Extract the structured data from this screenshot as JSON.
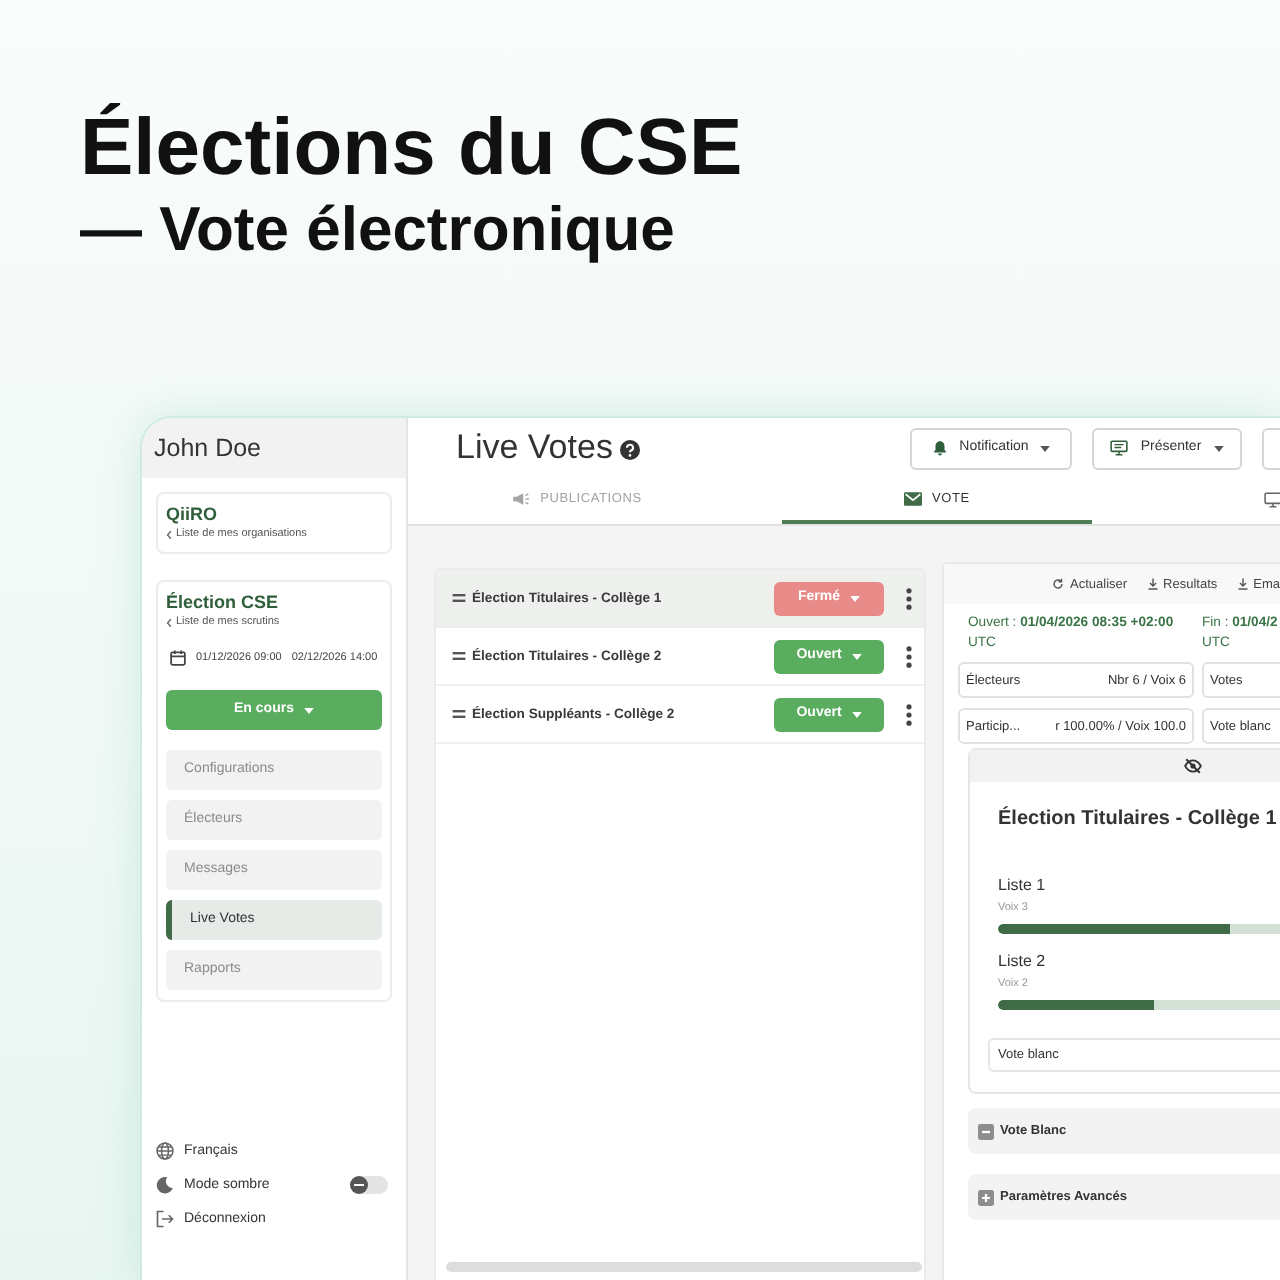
{
  "hero": {
    "title": "Élections du CSE",
    "subtitle": "— Vote électronique"
  },
  "sidebar": {
    "user": "John Doe",
    "organization": {
      "name": "QiiRO",
      "back_link": "Liste de mes organisations"
    },
    "election": {
      "name": "Élection CSE",
      "back_link": "Liste de mes scrutins",
      "start": "01/12/2026 09:00",
      "end": "02/12/2026 14:00",
      "status": "En cours"
    },
    "nav": [
      {
        "label": "Configurations",
        "selected": false
      },
      {
        "label": "Électeurs",
        "selected": false
      },
      {
        "label": "Messages",
        "selected": false
      },
      {
        "label": "Live Votes",
        "selected": true
      },
      {
        "label": "Rapports",
        "selected": false
      }
    ],
    "footer": [
      {
        "kind": "language",
        "label": "Français"
      },
      {
        "kind": "toggle",
        "label": "Mode sombre",
        "on": false
      },
      {
        "kind": "logout",
        "label": "Déconnexion"
      }
    ]
  },
  "header": {
    "title": "Live Votes",
    "buttons": [
      {
        "kind": "notification",
        "label": "Notification"
      },
      {
        "kind": "present",
        "label": "Présenter"
      }
    ]
  },
  "tabs": [
    {
      "kind": "publications",
      "label": "PUBLICATIONS",
      "selected": false
    },
    {
      "kind": "vote",
      "label": "VOTE",
      "selected": true
    },
    {
      "kind": "screen",
      "selected": false
    }
  ],
  "elections": [
    {
      "name": "Élection Titulaires - Collège 1",
      "selected": true,
      "status": "Fermé",
      "color": "#e88a87"
    },
    {
      "name": "Élection Titulaires - Collège 2",
      "selected": false,
      "status": "Ouvert",
      "color": "#5aac5f"
    },
    {
      "name": "Élection Suppléants - Collège 2",
      "selected": false,
      "status": "Ouvert",
      "color": "#5aac5f"
    }
  ],
  "results": {
    "actions": [
      {
        "kind": "refresh",
        "label": "Actualiser"
      },
      {
        "kind": "download",
        "label": "Resultats"
      },
      {
        "kind": "download",
        "label": "Ema"
      }
    ],
    "period": [
      {
        "label": "Ouvert :",
        "value": "01/04/2026 08:35 +02:00",
        "zone": "UTC"
      },
      {
        "label": "Fin :",
        "value": "01/04/2",
        "zone": "UTC"
      }
    ],
    "stats": [
      {
        "label": "Électeurs",
        "value": "Nbr 6 / Voix 6"
      },
      {
        "label": "Votes"
      },
      {
        "label": "Particip...",
        "value": "r 100.00% / Voix 100.0"
      },
      {
        "label": "Vote blanc"
      }
    ],
    "card": {
      "title": "Élection Titulaires - Collège 1",
      "lists": [
        {
          "name": "Liste 1",
          "votes": "Voix 3",
          "level": 0.82
        },
        {
          "name": "Liste 2",
          "votes": "Voix 2",
          "level": 0.55
        }
      ],
      "blank": "Vote blanc"
    },
    "sections": [
      {
        "kind": "collapse",
        "label": "Vote Blanc"
      },
      {
        "kind": "expand",
        "label": "Paramètres Avancés"
      }
    ]
  }
}
